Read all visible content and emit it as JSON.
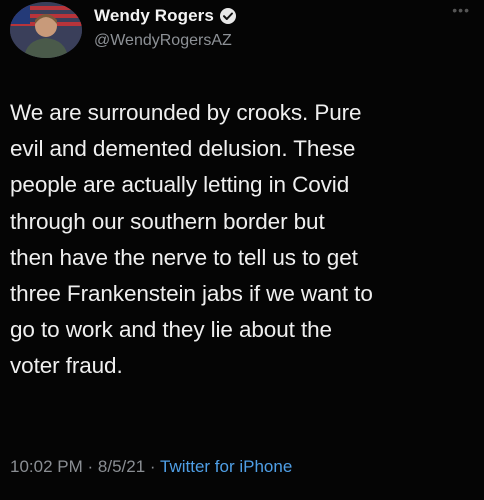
{
  "author": {
    "display_name": "Wendy Rogers",
    "handle": "@WendyRogersAZ",
    "verified_icon": "verified-badge-icon",
    "avatar_icon": "profile-photo"
  },
  "tweet": {
    "text": "We are surrounded by crooks. Pure\nevil and demented delusion. These\npeople are actually letting in Covid\nthrough our southern border but\nthen have the nerve to tell us to get\nthree Frankenstein jabs if we want to\ngo to work and they lie about the\nvoter fraud.",
    "time": "10:02 PM",
    "date": "8/5/21",
    "separator": "·",
    "client": "Twitter for iPhone"
  },
  "colors": {
    "background": "#050505",
    "link": "#4f9fe6",
    "muted": "#8a8e93"
  }
}
